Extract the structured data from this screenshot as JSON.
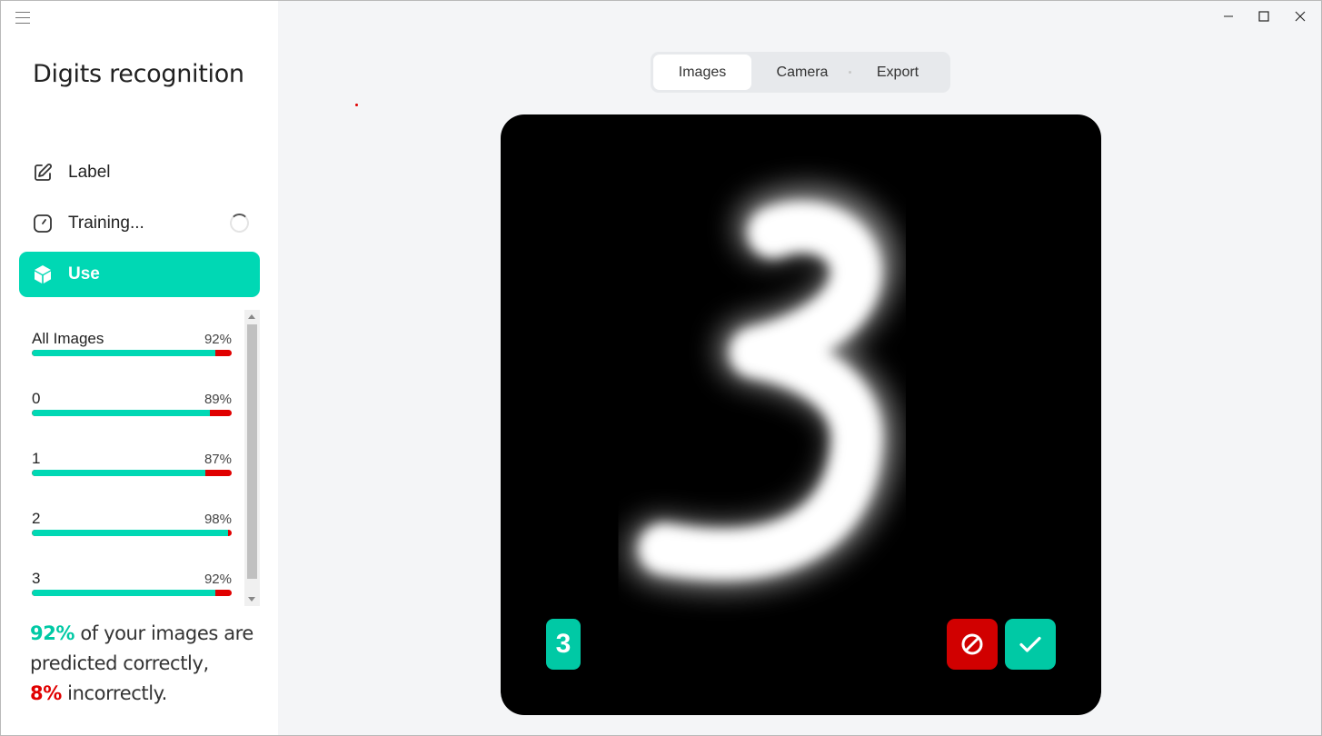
{
  "app": {
    "title": "Digits recognition",
    "accent_color": "#00d8b4",
    "error_color": "#e00000"
  },
  "nav": {
    "items": [
      {
        "label": "Label",
        "icon": "edit-icon"
      },
      {
        "label": "Training...",
        "icon": "timer-icon",
        "status": "loading"
      },
      {
        "label": "Use",
        "icon": "cube-icon",
        "active": true
      }
    ]
  },
  "stats": {
    "items": [
      {
        "name": "All Images",
        "percent": "92%",
        "value": 0.92
      },
      {
        "name": "0",
        "percent": "89%",
        "value": 0.89
      },
      {
        "name": "1",
        "percent": "87%",
        "value": 0.87
      },
      {
        "name": "2",
        "percent": "98%",
        "value": 0.98
      },
      {
        "name": "3",
        "percent": "92%",
        "value": 0.92
      }
    ]
  },
  "summary": {
    "correct_pct": "92%",
    "correct_text": " of your images are predicted correctly,",
    "incorrect_pct": "8%",
    "incorrect_text": " incorrectly."
  },
  "tabs": [
    {
      "label": "Images",
      "active": true
    },
    {
      "label": "Camera"
    },
    {
      "label": "Export"
    }
  ],
  "image": {
    "prediction": "3"
  },
  "actions": {
    "reject_icon": "block-icon",
    "accept_icon": "check-icon"
  }
}
